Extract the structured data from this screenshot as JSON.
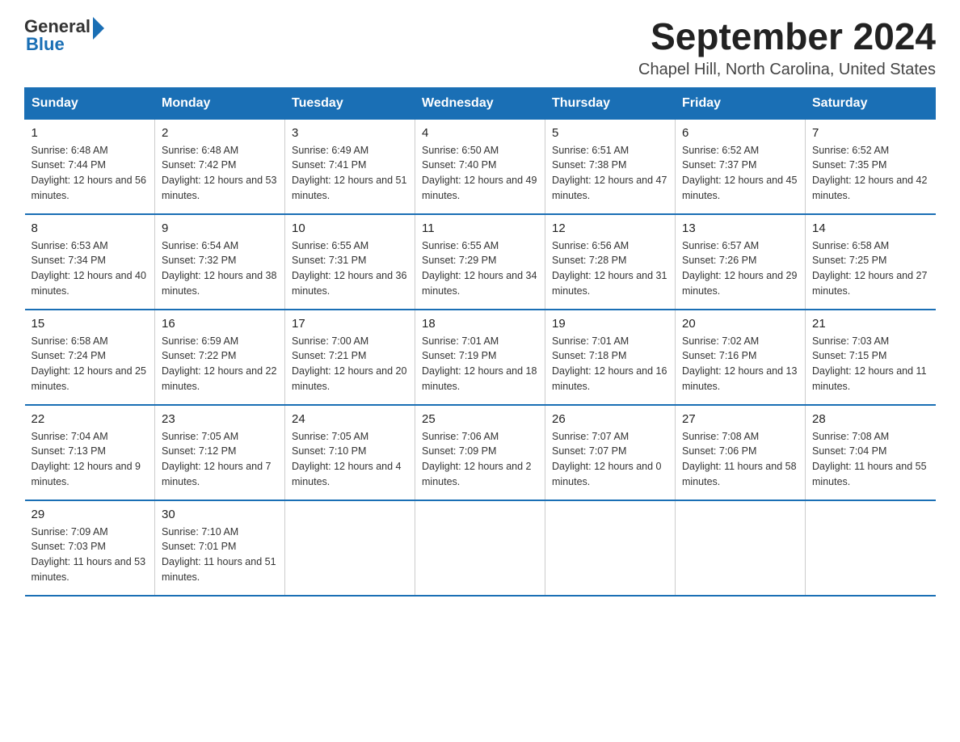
{
  "logo": {
    "general": "General",
    "blue": "Blue",
    "line2": "Blue"
  },
  "title": {
    "month_year": "September 2024",
    "location": "Chapel Hill, North Carolina, United States"
  },
  "weekdays": [
    "Sunday",
    "Monday",
    "Tuesday",
    "Wednesday",
    "Thursday",
    "Friday",
    "Saturday"
  ],
  "weeks": [
    [
      {
        "day": "1",
        "sunrise": "6:48 AM",
        "sunset": "7:44 PM",
        "daylight": "12 hours and 56 minutes."
      },
      {
        "day": "2",
        "sunrise": "6:48 AM",
        "sunset": "7:42 PM",
        "daylight": "12 hours and 53 minutes."
      },
      {
        "day": "3",
        "sunrise": "6:49 AM",
        "sunset": "7:41 PM",
        "daylight": "12 hours and 51 minutes."
      },
      {
        "day": "4",
        "sunrise": "6:50 AM",
        "sunset": "7:40 PM",
        "daylight": "12 hours and 49 minutes."
      },
      {
        "day": "5",
        "sunrise": "6:51 AM",
        "sunset": "7:38 PM",
        "daylight": "12 hours and 47 minutes."
      },
      {
        "day": "6",
        "sunrise": "6:52 AM",
        "sunset": "7:37 PM",
        "daylight": "12 hours and 45 minutes."
      },
      {
        "day": "7",
        "sunrise": "6:52 AM",
        "sunset": "7:35 PM",
        "daylight": "12 hours and 42 minutes."
      }
    ],
    [
      {
        "day": "8",
        "sunrise": "6:53 AM",
        "sunset": "7:34 PM",
        "daylight": "12 hours and 40 minutes."
      },
      {
        "day": "9",
        "sunrise": "6:54 AM",
        "sunset": "7:32 PM",
        "daylight": "12 hours and 38 minutes."
      },
      {
        "day": "10",
        "sunrise": "6:55 AM",
        "sunset": "7:31 PM",
        "daylight": "12 hours and 36 minutes."
      },
      {
        "day": "11",
        "sunrise": "6:55 AM",
        "sunset": "7:29 PM",
        "daylight": "12 hours and 34 minutes."
      },
      {
        "day": "12",
        "sunrise": "6:56 AM",
        "sunset": "7:28 PM",
        "daylight": "12 hours and 31 minutes."
      },
      {
        "day": "13",
        "sunrise": "6:57 AM",
        "sunset": "7:26 PM",
        "daylight": "12 hours and 29 minutes."
      },
      {
        "day": "14",
        "sunrise": "6:58 AM",
        "sunset": "7:25 PM",
        "daylight": "12 hours and 27 minutes."
      }
    ],
    [
      {
        "day": "15",
        "sunrise": "6:58 AM",
        "sunset": "7:24 PM",
        "daylight": "12 hours and 25 minutes."
      },
      {
        "day": "16",
        "sunrise": "6:59 AM",
        "sunset": "7:22 PM",
        "daylight": "12 hours and 22 minutes."
      },
      {
        "day": "17",
        "sunrise": "7:00 AM",
        "sunset": "7:21 PM",
        "daylight": "12 hours and 20 minutes."
      },
      {
        "day": "18",
        "sunrise": "7:01 AM",
        "sunset": "7:19 PM",
        "daylight": "12 hours and 18 minutes."
      },
      {
        "day": "19",
        "sunrise": "7:01 AM",
        "sunset": "7:18 PM",
        "daylight": "12 hours and 16 minutes."
      },
      {
        "day": "20",
        "sunrise": "7:02 AM",
        "sunset": "7:16 PM",
        "daylight": "12 hours and 13 minutes."
      },
      {
        "day": "21",
        "sunrise": "7:03 AM",
        "sunset": "7:15 PM",
        "daylight": "12 hours and 11 minutes."
      }
    ],
    [
      {
        "day": "22",
        "sunrise": "7:04 AM",
        "sunset": "7:13 PM",
        "daylight": "12 hours and 9 minutes."
      },
      {
        "day": "23",
        "sunrise": "7:05 AM",
        "sunset": "7:12 PM",
        "daylight": "12 hours and 7 minutes."
      },
      {
        "day": "24",
        "sunrise": "7:05 AM",
        "sunset": "7:10 PM",
        "daylight": "12 hours and 4 minutes."
      },
      {
        "day": "25",
        "sunrise": "7:06 AM",
        "sunset": "7:09 PM",
        "daylight": "12 hours and 2 minutes."
      },
      {
        "day": "26",
        "sunrise": "7:07 AM",
        "sunset": "7:07 PM",
        "daylight": "12 hours and 0 minutes."
      },
      {
        "day": "27",
        "sunrise": "7:08 AM",
        "sunset": "7:06 PM",
        "daylight": "11 hours and 58 minutes."
      },
      {
        "day": "28",
        "sunrise": "7:08 AM",
        "sunset": "7:04 PM",
        "daylight": "11 hours and 55 minutes."
      }
    ],
    [
      {
        "day": "29",
        "sunrise": "7:09 AM",
        "sunset": "7:03 PM",
        "daylight": "11 hours and 53 minutes."
      },
      {
        "day": "30",
        "sunrise": "7:10 AM",
        "sunset": "7:01 PM",
        "daylight": "11 hours and 51 minutes."
      },
      null,
      null,
      null,
      null,
      null
    ]
  ]
}
